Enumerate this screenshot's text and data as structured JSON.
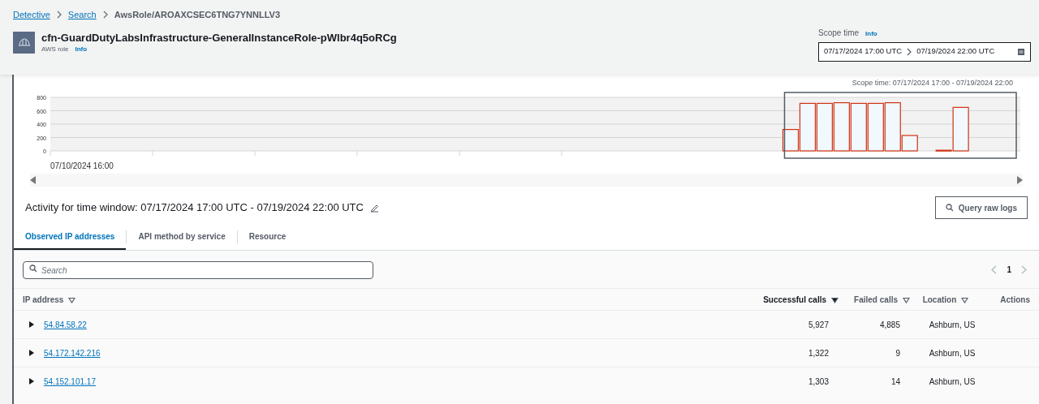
{
  "breadcrumbs": [
    {
      "label": "Detective",
      "link": true
    },
    {
      "label": "Search",
      "link": true
    },
    {
      "label": "AwsRole/AROAXCSEC6TNG7YNNLLV3",
      "link": false
    }
  ],
  "entity": {
    "title": "cfn-GuardDutyLabsInfrastructure-GeneralInstanceRole-pWlbr4q5oRCg",
    "type": "AWS role",
    "info": "Info"
  },
  "scope_time": {
    "label": "Scope time",
    "info": "Info",
    "start": "07/17/2024 17:00 UTC",
    "end": "07/19/2024 22:00 UTC"
  },
  "chart_data": {
    "type": "bar",
    "annotations": [
      "Scope time: 07/17/2024 17:00 - 07/19/2024 22:00",
      "07/10/2024 16:00"
    ],
    "ylim": [
      0,
      800
    ],
    "yticks": [
      0,
      200,
      400,
      600,
      800
    ],
    "grid": true,
    "series": [
      {
        "color": "#d13212",
        "values": [
          null,
          null,
          null,
          null,
          null,
          null,
          null,
          null,
          null,
          null,
          null,
          null,
          null,
          null,
          null,
          null,
          null,
          null,
          null,
          null,
          null,
          null,
          null,
          null,
          null,
          null,
          null,
          null,
          null,
          null,
          null,
          null,
          null,
          null,
          null,
          null,
          null,
          null,
          null,
          null,
          null,
          null,
          null,
          320,
          710,
          710,
          720,
          710,
          710,
          720,
          230,
          null,
          10,
          650,
          null,
          null,
          null
        ]
      }
    ]
  },
  "activity": {
    "heading": "Activity for time window: 07/17/2024 17:00 UTC - 07/19/2024 22:00 UTC",
    "button": "Query raw logs"
  },
  "tabs": [
    {
      "label": "Observed IP addresses",
      "selected": true
    },
    {
      "label": "API method by service",
      "selected": false
    },
    {
      "label": "Resource",
      "selected": false
    }
  ],
  "search": {
    "placeholder": "Search"
  },
  "pagination": {
    "page": "1"
  },
  "table": {
    "columns": [
      {
        "label": "IP address",
        "sorted": false,
        "sortable": true
      },
      {
        "label": "Successful calls",
        "sorted": true,
        "sortable": true
      },
      {
        "label": "Failed calls",
        "sorted": false,
        "sortable": true
      },
      {
        "label": "Location",
        "sorted": false,
        "sortable": true
      },
      {
        "label": "Actions",
        "sorted": false,
        "sortable": false
      }
    ],
    "rows": [
      {
        "ip": "54.84.58.22",
        "successful": "5,927",
        "failed": "4,885",
        "location": "Ashburn, US"
      },
      {
        "ip": "54.172.142.216",
        "successful": "1,322",
        "failed": "9",
        "location": "Ashburn, US"
      },
      {
        "ip": "54.152.101.17",
        "successful": "1,303",
        "failed": "14",
        "location": "Ashburn, US"
      }
    ]
  }
}
